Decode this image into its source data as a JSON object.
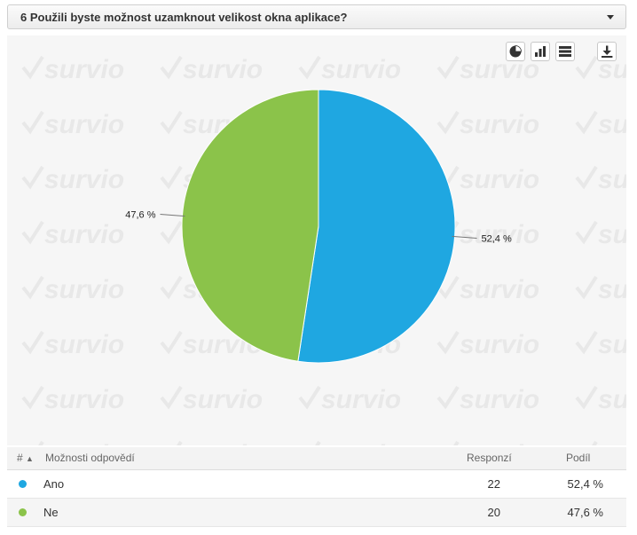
{
  "question": {
    "title": "6 Použili byste možnost uzamknout velikost okna aplikace?"
  },
  "toolbar": {
    "icons": [
      "pie-chart-icon",
      "bar-chart-icon",
      "table-icon",
      "download-icon"
    ]
  },
  "watermark": {
    "text": "survio"
  },
  "chart_data": {
    "type": "pie",
    "slices": [
      {
        "category": "Ano",
        "value": 52.4,
        "label": "52,4 %",
        "color": "#1fa7e1"
      },
      {
        "category": "Ne",
        "value": 47.6,
        "label": "47,6 %",
        "color": "#8bc34a"
      }
    ]
  },
  "table": {
    "headers": {
      "index": "#",
      "options": "Možnosti odpovědí",
      "responses": "Responzí",
      "share": "Podíl"
    },
    "rows": [
      {
        "label": "Ano",
        "responses": "22",
        "share": "52,4 %",
        "color": "#1fa7e1"
      },
      {
        "label": "Ne",
        "responses": "20",
        "share": "47,6 %",
        "color": "#8bc34a"
      }
    ]
  }
}
